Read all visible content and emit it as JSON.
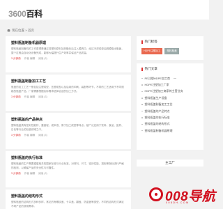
{
  "header": {
    "logo_number": "3600",
    "logo_text": "百科"
  },
  "breadcrumb": {
    "text": "现在位置 » 首页"
  },
  "articles": [
    {
      "title": "塑料瓶盖制备机器原理",
      "excerpt": "塑料瓶盖制备机的工作原理是通过将塑料原料加热融化后注入模具中，经过冷却成型后脱模取出瓶盖，整个过程由自动化设备完成，能够大幅提升生产效率并保证产品质量。",
      "meta": [
        "3 分钟前",
        "作者 编辑",
        "阅读 (3)"
      ]
    },
    {
      "title": "塑料瓶盖制备加工工艺",
      "excerpt": "瓶盖的加工工艺一般包括注塑成型、压塑成型以及后续的印刷、装配等环节，不同的工艺适用于不同规格的瓶盖产品，厂家需要根据实际需求选择合适的加工方式。",
      "meta": [
        "3 分钟前",
        "作者 编辑",
        "阅读 (3)"
      ]
    },
    {
      "title": "塑料瓶盖的产品特点",
      "excerpt": "塑料瓶盖具有密封性能好、重量轻、成本低、易于加工成型等特点，被广泛应用于饮料、食品、医药、日化等行业的包装领域之中。",
      "meta": [
        "3 分钟前",
        "作者 编辑",
        "阅读 (3)"
      ]
    },
    {
      "title": "塑料瓶盖的执行标准",
      "excerpt": "塑料瓶盖的生产需要遵循相关的国家标准与行业标准，对材料、尺寸、密封性能、扭矩等指标进行严格的检测，以确保产品的安全性与可靠性。",
      "meta": [
        "3 分钟前",
        "作者 编辑",
        "阅读 (3)"
      ]
    },
    {
      "title": "塑料瓶盖的结构形式",
      "excerpt": "塑料瓶盖的结构形式多种多样，常见的有螺纹盖、卡口盖、翻盖、防盗盖等类型，不同的结构形式满足不同产品的使用需求。",
      "meta": []
    }
  ],
  "sidebar": {
    "hot_tags_heading": "热门标签",
    "hot_tags": [
      "HDPE注塑加工",
      "塑料瓶盖"
    ],
    "list_heading": "热门文章",
    "list_items": [
      "PE注塑HDPE加工商",
      "HDPE注塑加工厂家",
      "HDPE注塑加工商家的主营业务",
      "塑料瓶盖生产设备",
      "塑料瓶盖制备加工工艺",
      "塑料瓶盖的产品特点",
      "塑料瓶盖的执行标准",
      "塑料瓶盖的结构形式",
      "塑料瓶盖制备机器原理"
    ],
    "bottom_title": "主工厂"
  },
  "watermark": {
    "text": "008导航",
    "sub": "008DH.COM"
  }
}
